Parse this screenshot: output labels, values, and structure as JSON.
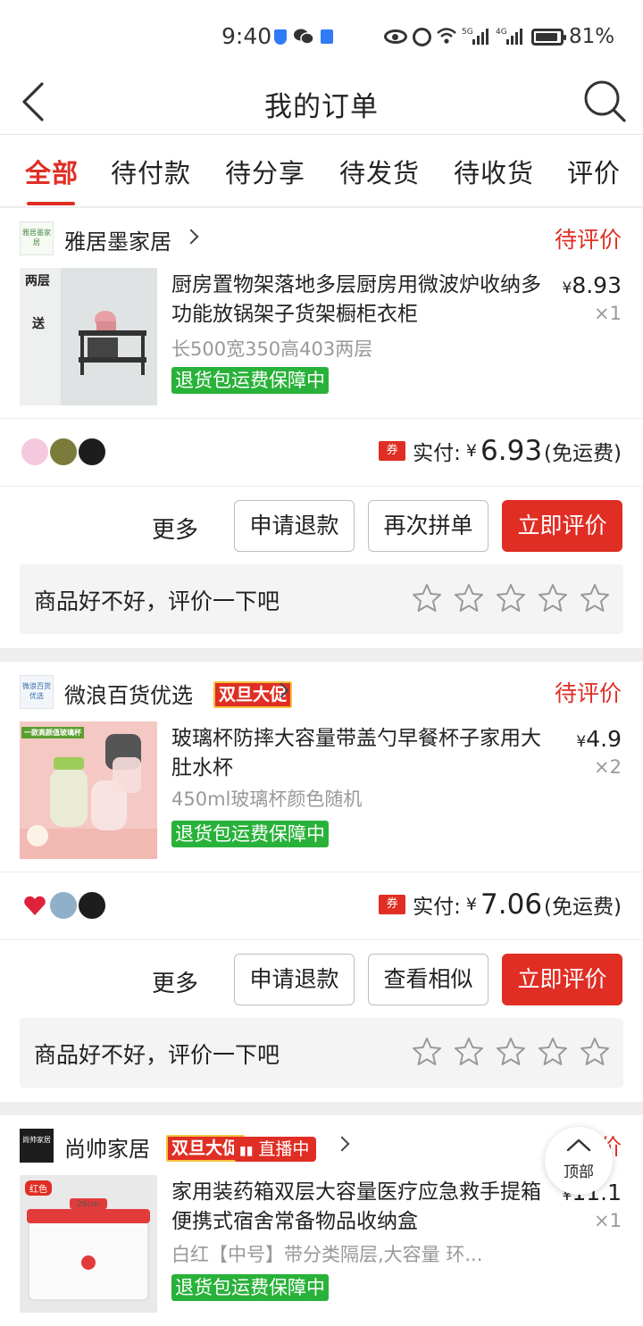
{
  "status_bar": {
    "time": "9:40",
    "battery": "81%",
    "net1": "5G",
    "net2": "4G"
  },
  "header": {
    "title": "我的订单"
  },
  "tabs": [
    {
      "label": "全部",
      "active": true
    },
    {
      "label": "待付款"
    },
    {
      "label": "待分享"
    },
    {
      "label": "待发货"
    },
    {
      "label": "待收货"
    },
    {
      "label": "评价"
    }
  ],
  "orders": [
    {
      "shop": "雅居墨家居",
      "shop_logo_text": "雅居墨家居",
      "status": "待评价",
      "title": "厨房置物架落地多层厨房用微波炉收纳多功能放锅架子货架橱柜衣柜",
      "spec": "长500宽350高403两层",
      "badge": "退货包运费保障中",
      "price": "8.93",
      "qty": "×1",
      "thumb_text": "两层",
      "thumb_text2": "送",
      "coupon": "券",
      "pay_label": "实付:",
      "yen": "¥",
      "pay_amount": "6.93",
      "shipping": "(免运费)",
      "more": "更多",
      "btn1": "申请退款",
      "btn2": "再次拼单",
      "btn3": "立即评价",
      "review_prompt": "商品好不好，评价一下吧"
    },
    {
      "shop": "微浪百货优选",
      "shop_logo_text": "微浪百货优选",
      "promo": "双旦大促",
      "status": "待评价",
      "title": "玻璃杯防摔大容量带盖勺早餐杯子家用大肚水杯",
      "spec": "450ml玻璃杯颜色随机",
      "badge": "退货包运费保障中",
      "price": "4.9",
      "qty": "×2",
      "thumb_text": "一款高颜值玻璃杯",
      "coupon": "券",
      "pay_label": "实付:",
      "yen": "¥",
      "pay_amount": "7.06",
      "shipping": "(免运费)",
      "more": "更多",
      "btn1": "申请退款",
      "btn2": "查看相似",
      "btn3": "立即评价",
      "review_prompt": "商品好不好，评价一下吧"
    },
    {
      "shop": "尚帅家居",
      "shop_logo_text": "尚帅家居",
      "promo": "双旦大促",
      "live": "直播中",
      "status": "待评价",
      "title": "家用装药箱双层大容量医疗应急救手提箱便携式宿舍常备物品收纳盒",
      "spec": "白红【中号】带分类隔层,大容量 环...",
      "badge": "退货包运费保障中",
      "price": "11.1",
      "qty": "×1",
      "thumb_text": "红色",
      "thumb_dim": "26cm"
    }
  ],
  "scroll_top": "顶部",
  "colors": {
    "accent": "#e02e24",
    "badge_green": "#29b23a",
    "background": "#eeeeee"
  }
}
